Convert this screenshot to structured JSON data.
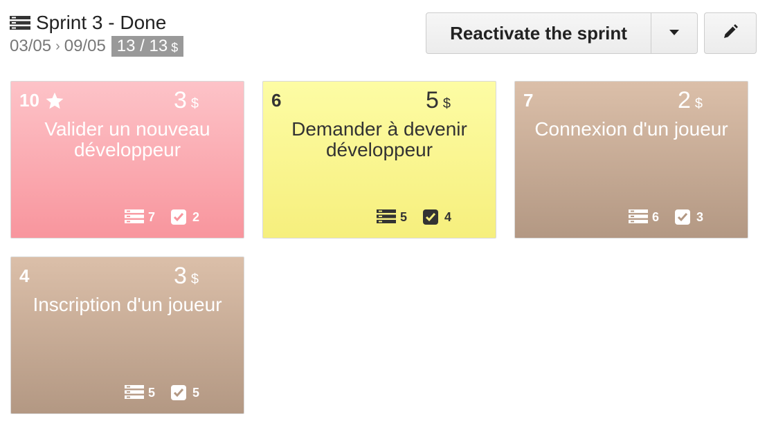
{
  "sprint": {
    "title": "Sprint 3 - Done",
    "start_date": "03/05",
    "end_date": "09/05",
    "budget": "13 / 13",
    "currency": "$"
  },
  "actions": {
    "reactivate_label": "Reactivate the sprint"
  },
  "icons": {
    "title": "list-icon",
    "caret": "caret-down-icon",
    "edit": "pencil-icon",
    "star": "star-icon",
    "tasks": "list-icon",
    "criteria": "checkbox-icon"
  },
  "colors": {
    "red": "#f8959d",
    "yellow": "#f6ef7d",
    "brown": "#b39883"
  },
  "stories": [
    {
      "id": "10",
      "starred": true,
      "points": "3",
      "currency": "$",
      "title": "Valider un nouveau développeur",
      "tasks": "7",
      "criteria": "2",
      "color": "red"
    },
    {
      "id": "6",
      "starred": false,
      "points": "5",
      "currency": "$",
      "title": "Demander à devenir développeur",
      "tasks": "5",
      "criteria": "4",
      "color": "yellow"
    },
    {
      "id": "7",
      "starred": false,
      "points": "2",
      "currency": "$",
      "title": "Connexion d'un joueur",
      "tasks": "6",
      "criteria": "3",
      "color": "brown"
    },
    {
      "id": "4",
      "starred": false,
      "points": "3",
      "currency": "$",
      "title": "Inscription d'un joueur",
      "tasks": "5",
      "criteria": "5",
      "color": "brown"
    }
  ]
}
